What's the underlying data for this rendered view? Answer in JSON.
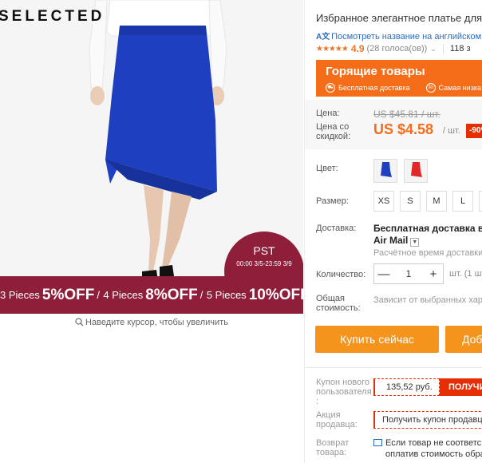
{
  "gallery": {
    "brand": "SELECTED",
    "promo_pst": "PST",
    "promo_dates": "00:00 3/5-23:59 3/9",
    "promo": [
      {
        "pieces": "3 Pieces",
        "off": "5%OFF"
      },
      {
        "pieces": "4 Pieces",
        "off": "8%OFF"
      },
      {
        "pieces": "5 Pieces",
        "off": "10%OFF"
      }
    ],
    "promo_sep": "/",
    "zoom_hint": "Наведите курсор, чтобы увеличить",
    "skirt_color": "#1e3fbf"
  },
  "product": {
    "title": "Избранное элегантное платье для",
    "translate_link": "Посмотреть название на английском",
    "translate_icon": "A文",
    "stars": "★★★★★",
    "rating": "4.9",
    "votes": "(28 голоса(ов))",
    "orders": "118 з"
  },
  "hot_deals": {
    "title": "Горящие товары",
    "free_delivery": "Бесплатная доставка",
    "lowest": "Самая низка",
    "days_badge": "30"
  },
  "price": {
    "label": "Цена:",
    "old": "US $45.81 / шт.",
    "discount_label": "Цена со скидкой:",
    "new": "US $4.58",
    "per": "/ шт.",
    "discount": "-90%"
  },
  "options": {
    "color_label": "Цвет:",
    "colors": [
      "#1f3fbf",
      "#e02828"
    ],
    "size_label": "Размер:",
    "sizes": [
      "XS",
      "S",
      "M",
      "L",
      "X"
    ]
  },
  "delivery": {
    "label": "Доставка:",
    "value_line1": "Бесплатная доставка в Ru",
    "value_line2": "Air Mail",
    "estimate": "Расчётное время доставки:"
  },
  "quantity": {
    "label": "Количество:",
    "value": "1",
    "minus": "—",
    "plus": "+",
    "note": "шт. (1 шт"
  },
  "total": {
    "label": "Общая стоимость:",
    "note": "Зависит от выбранных хара"
  },
  "actions": {
    "buy_now": "Купить сейчас",
    "add_to_cart": "Доб"
  },
  "coupons": {
    "new_user_label": "Купон нового пользователя :",
    "new_user_amount": "135,52 руб.",
    "new_user_get": "ПОЛУЧИ",
    "seller_label": "Акция продавца:",
    "seller_text": "Получить купон продавца",
    "returns_label": "Возврат товара:",
    "returns_line1": "Если товар не соответс",
    "returns_line2": "оплатив стоимость обра"
  },
  "colors_theme": {
    "accent_orange": "#f56d19",
    "button_orange": "#f5941d",
    "red": "#e62e04",
    "promo_maroon": "#8e1e3a",
    "link_blue": "#2c6bbf"
  }
}
